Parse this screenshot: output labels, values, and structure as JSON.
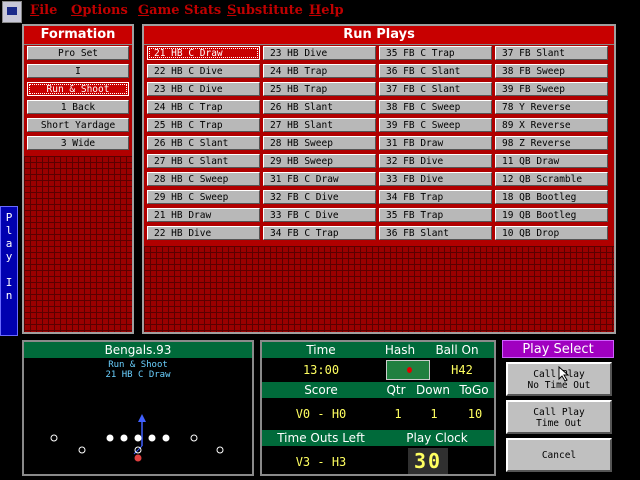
{
  "menu": [
    "File",
    "Options",
    "Game Stats",
    "Substitute",
    "Help"
  ],
  "formation": {
    "title": "Formation",
    "items": [
      "Pro Set",
      "I",
      "Run & Shoot",
      "1 Back",
      "Short Yardage",
      "3 Wide"
    ],
    "selected": "Run & Shoot"
  },
  "run_plays": {
    "title": "Run Plays",
    "columns": [
      [
        "21 HB C Draw",
        "22 HB C Dive",
        "23 HB C Dive",
        "24 HB C Trap",
        "25 HB C Trap",
        "26 HB C Slant",
        "27 HB C Slant",
        "28 HB C Sweep",
        "29 HB C Sweep",
        "21 HB Draw",
        "22 HB Dive"
      ],
      [
        "23 HB Dive",
        "24 HB Trap",
        "25 HB Trap",
        "26 HB Slant",
        "27 HB Slant",
        "28 HB Sweep",
        "29 HB Sweep",
        "31 FB C Draw",
        "32 FB C Dive",
        "33 FB C Dive",
        "34 FB C Trap"
      ],
      [
        "35 FB C Trap",
        "36 FB C Slant",
        "37 FB C Slant",
        "38 FB C Sweep",
        "39 FB C Sweep",
        "31 FB Draw",
        "32 FB Dive",
        "33 FB Dive",
        "34 FB Trap",
        "35 FB Trap",
        "36 FB Slant"
      ],
      [
        "37 FB Slant",
        "38 FB Sweep",
        "39 FB Sweep",
        "78 Y Reverse",
        "89 X Reverse",
        "98 Z Reverse",
        "11 QB Draw",
        "12 QB Scramble",
        "18 QB Bootleg",
        "19 QB Bootleg",
        "10 QB Drop"
      ]
    ],
    "selected": "21 HB C Draw"
  },
  "side_tab": "Play In",
  "field": {
    "team": "Bengals.93",
    "formation": "Run & Shoot",
    "play": "21 HB C Draw"
  },
  "status": {
    "time_label": "Time",
    "time": "13:00",
    "hash_label": "Hash",
    "ball_on_label": "Ball On",
    "ball_on": "H42",
    "score_label": "Score",
    "score": "V0 - H0",
    "qtr_label": "Qtr",
    "qtr": "1",
    "down_label": "Down",
    "down": "1",
    "togo_label": "ToGo",
    "togo": "10",
    "timeouts_label": "Time Outs Left",
    "timeouts": "V3 - H3",
    "playclock_label": "Play Clock",
    "playclock": "30"
  },
  "play_select": {
    "title": "Play Select",
    "buttons": [
      {
        "line1": "Call Play",
        "line2": "No Time Out"
      },
      {
        "line1": "Call Play",
        "line2": "Time Out"
      },
      {
        "line1": "Cancel",
        "line2": ""
      }
    ]
  },
  "colors": {
    "accent": "#b00000",
    "header_green": "#006a3a",
    "select_purple": "#a000c0",
    "value_yellow": "#ffff60"
  }
}
